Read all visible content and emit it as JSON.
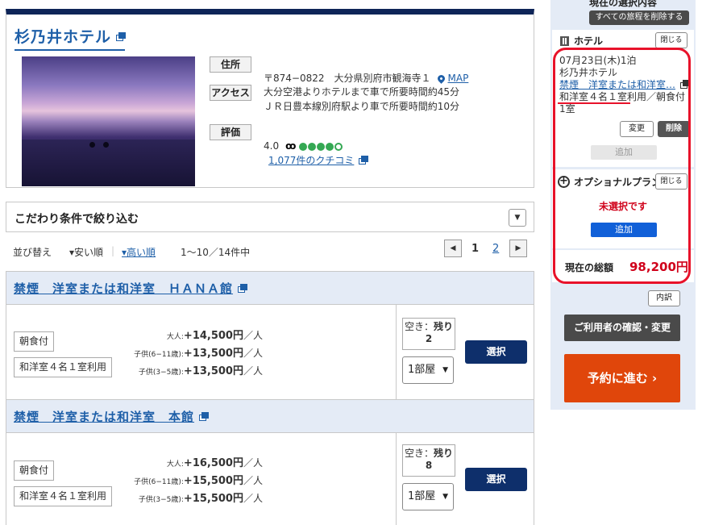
{
  "hotel": {
    "name": "杉乃井ホテル",
    "labels": {
      "address": "住所",
      "access": "アクセス",
      "rating": "評価"
    },
    "address": "〒874−0822　大分県別府市観海寺１",
    "map_link": "MAP",
    "access": "大分空港よりホテルまで車で所要時間約45分\nＪＲ日豊本線別府駅より車で所要時間約10分",
    "rating_score": "4.0",
    "rating_dots_filled": 4,
    "rating_dots_total": 5,
    "reviews_link": "1,077件のクチコミ"
  },
  "filter": {
    "title": "こだわり条件で絞り込む",
    "toggle": "▼"
  },
  "sort": {
    "label": "並び替え",
    "option_low": "▾安い順",
    "option_high": "▾高い順",
    "result_count": "1〜10／14件中"
  },
  "pager": {
    "prev": "◀",
    "next": "▶",
    "page1": "1",
    "page2": "2"
  },
  "plans": [
    {
      "title": "禁煙　洋室または和洋室　ＨＡＮＡ館",
      "tag1": "朝食付",
      "tag2": "和洋室４名１室利用",
      "adult_label": "大人:",
      "adult_price": "+14,500円",
      "child1_label": "子供(6−11歳):",
      "child1_price": "+13,500円",
      "child2_label": "子供(3−5歳):",
      "child2_price": "+13,500円",
      "per": "／人",
      "avail_label": "空き：",
      "avail_prefix": "残り",
      "avail_count": "2",
      "rooms": "1部屋",
      "select": "選択"
    },
    {
      "title": "禁煙　洋室または和洋室　本館",
      "tag1": "朝食付",
      "tag2": "和洋室４名１室利用",
      "adult_label": "大人:",
      "adult_price": "+16,500円",
      "child1_label": "子供(6−11歳):",
      "child1_price": "+15,500円",
      "child2_label": "子供(3−5歳):",
      "child2_price": "+15,500円",
      "per": "／人",
      "avail_label": "空き：",
      "avail_prefix": "残り",
      "avail_count": "8",
      "rooms": "1部屋",
      "select": "選択"
    }
  ],
  "sidebar": {
    "header": "現在の選択内容",
    "clear_all": "すべての旅程を削除する",
    "hotel_section": "ホテル",
    "close": "閉じる",
    "date_nights": "07月23日(木)1泊",
    "hotel_name": "杉乃井ホテル",
    "plan_link": "禁煙　洋室または和洋室…",
    "plan_detail_1": "和洋室４名１室利用／朝食付",
    "plan_detail_2": "1室",
    "change": "変更",
    "delete": "削除",
    "add": "追加",
    "optional_section": "オプショナルプラン",
    "optional_close": "閉じる",
    "unselected": "未選択です",
    "optional_add": "追加",
    "total_label": "現在の総額",
    "total_value": "98,200円",
    "breakdown": "内訳",
    "confirm_users": "ご利用者の確認・変更",
    "proceed": "予約に進む ›"
  },
  "colors": {
    "accent": "#1e5fa8",
    "navy": "#0e2558",
    "price_red": "#d0021b",
    "cta_orange": "#e0460b",
    "annotation_red": "#e8122a"
  }
}
